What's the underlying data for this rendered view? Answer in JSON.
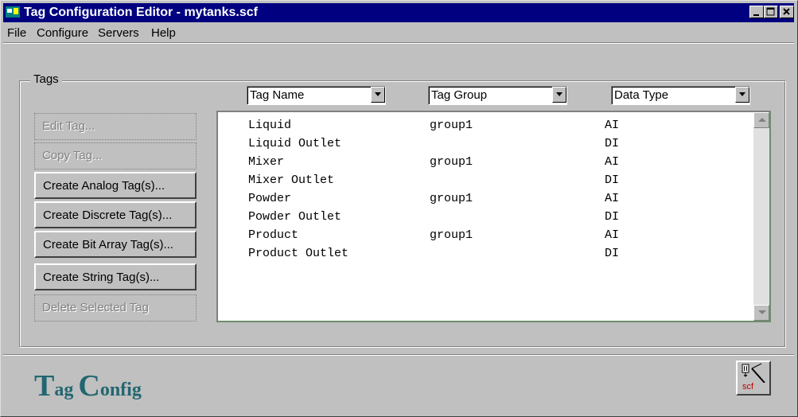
{
  "window": {
    "title": "Tag Configuration Editor - mytanks.scf"
  },
  "menu": [
    "File",
    "Configure",
    "Servers",
    "Help"
  ],
  "group_label": "Tags",
  "columns": {
    "tag_name": "Tag Name",
    "tag_group": "Tag Group",
    "data_type": "Data Type"
  },
  "buttons": {
    "edit_tag": "Edit Tag...",
    "copy_tag": "Copy Tag...",
    "create_analog": "Create Analog Tag(s)...",
    "create_discrete": "Create Discrete Tag(s)...",
    "create_bit_array": "Create Bit Array Tag(s)...",
    "create_string": "Create String Tag(s)...",
    "delete_selected": "Delete Selected Tag"
  },
  "tags": [
    {
      "name": "Liquid",
      "group": "group1",
      "type": "AI"
    },
    {
      "name": "Liquid Outlet",
      "group": "",
      "type": "DI"
    },
    {
      "name": "Mixer",
      "group": "group1",
      "type": "AI"
    },
    {
      "name": "Mixer Outlet",
      "group": "",
      "type": "DI"
    },
    {
      "name": "Powder",
      "group": "group1",
      "type": "AI"
    },
    {
      "name": "Powder Outlet",
      "group": "",
      "type": "DI"
    },
    {
      "name": "Product",
      "group": "group1",
      "type": "AI"
    },
    {
      "name": "Product Outlet",
      "group": "",
      "type": "DI"
    }
  ],
  "logo": {
    "t1": "T",
    "t2": "ag ",
    "c1": "C",
    "c2": "onfig"
  },
  "scf_icon_label": "scf",
  "colors": {
    "titlebar": "#000080",
    "logo": "#236670",
    "face": "#c0c0c0"
  }
}
